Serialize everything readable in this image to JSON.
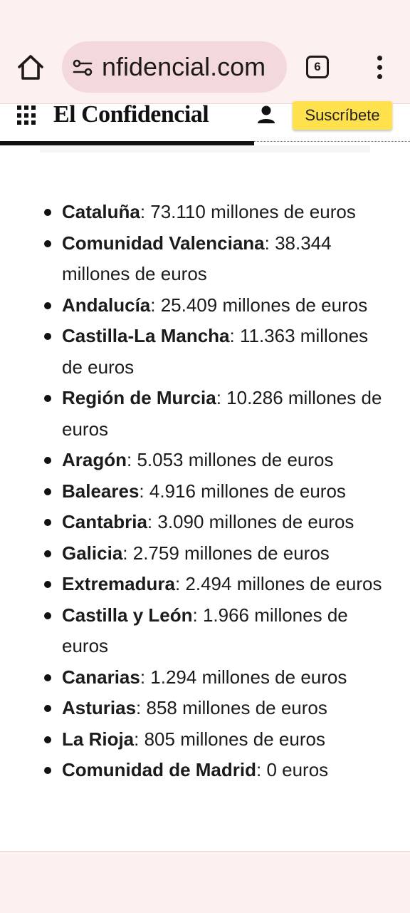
{
  "browser": {
    "url": "nfidencial.com",
    "tab_count": "6"
  },
  "header": {
    "logo": "El Confidencial",
    "subscribe_label": "Suscríbete"
  },
  "reading_progress": 0.62,
  "article": {
    "items": [
      {
        "region": "Cataluña",
        "value": ": 73.110 millones de euros"
      },
      {
        "region": "Comunidad Valenciana",
        "value": ": 38.344 millones de euros"
      },
      {
        "region": "Andalucía",
        "value": ": 25.409 millones de euros"
      },
      {
        "region": "Castilla-La Mancha",
        "value": ": 11.363 millones de euros"
      },
      {
        "region": "Región de Murcia",
        "value": ": 10.286 millones de euros"
      },
      {
        "region": "Aragón",
        "value": ": 5.053 millones de euros"
      },
      {
        "region": "Baleares",
        "value": ": 4.916 millones de euros"
      },
      {
        "region": "Cantabria",
        "value": ": 3.090 millones de euros"
      },
      {
        "region": "Galicia",
        "value": ": 2.759 millones de euros"
      },
      {
        "region": "Extremadura",
        "value": ": 2.494 millones de euros"
      },
      {
        "region": "Castilla y León",
        "value": ": 1.966 millones de euros"
      },
      {
        "region": "Canarias",
        "value": ": 1.294 millones de euros"
      },
      {
        "region": "Asturias",
        "value": ": 858 millones de euros"
      },
      {
        "region": "La Rioja",
        "value": ": 805 millones de euros"
      },
      {
        "region": "Comunidad de Madrid",
        "value": ": 0 euros"
      }
    ]
  }
}
